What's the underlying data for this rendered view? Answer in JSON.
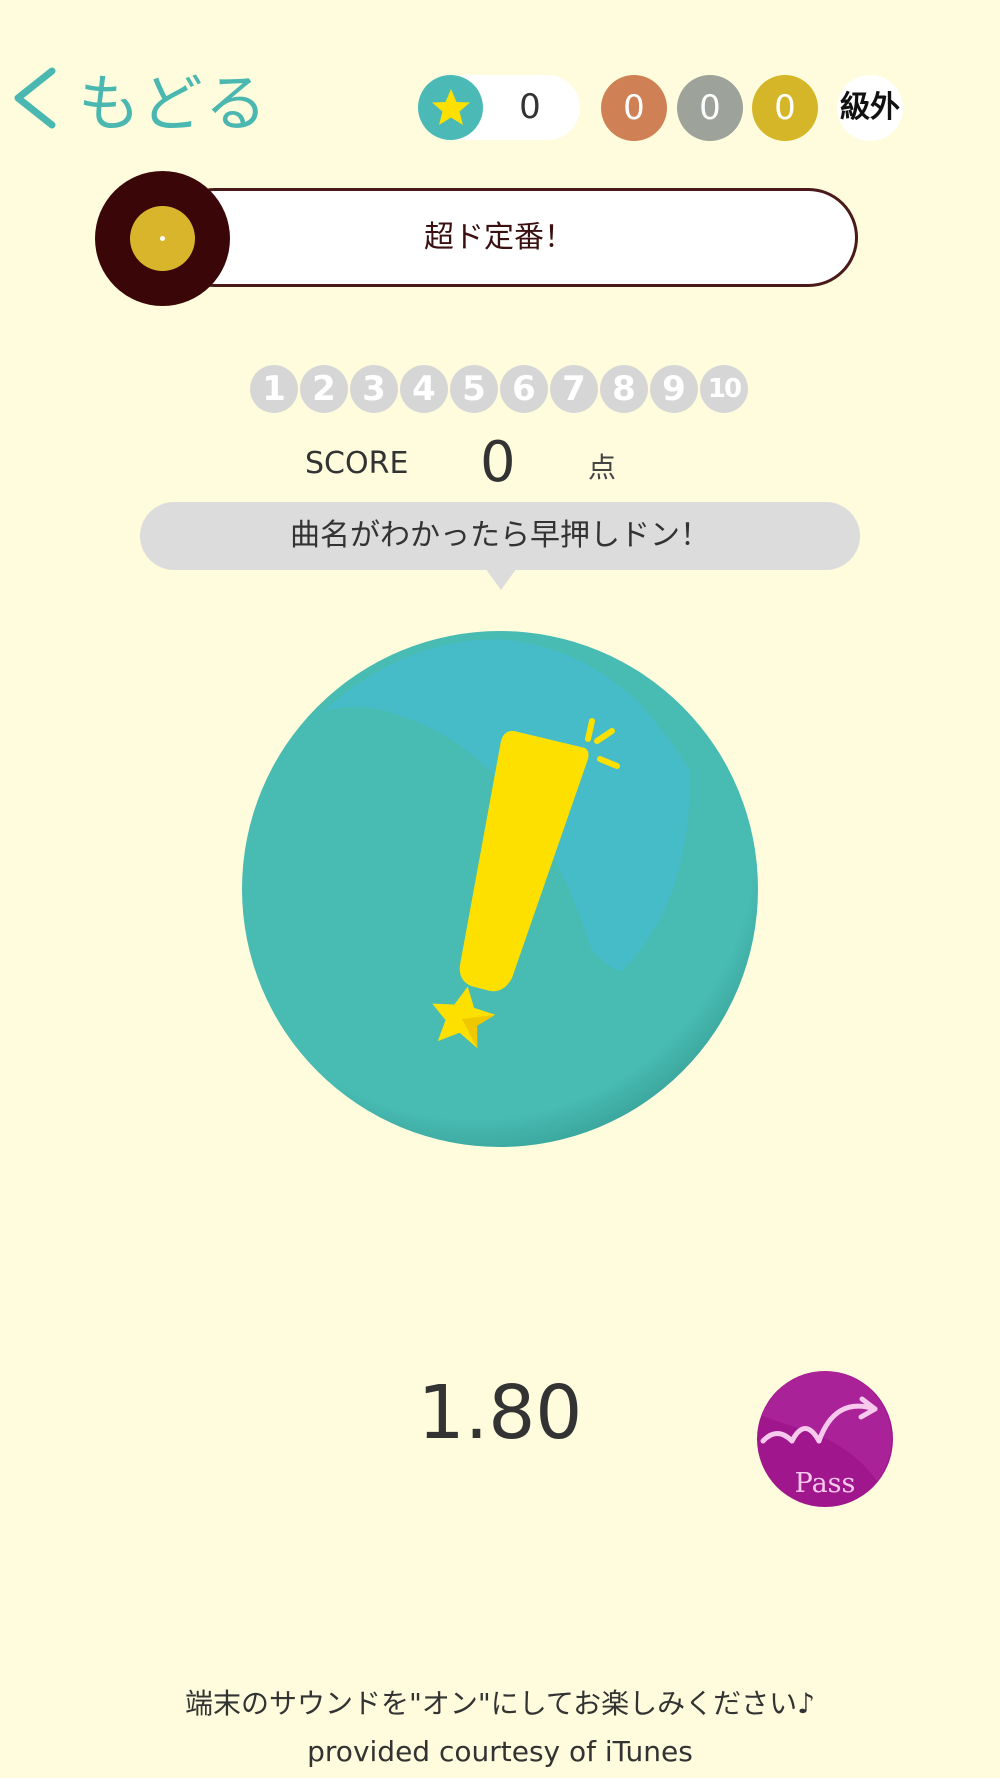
{
  "header": {
    "back_label": "もどる",
    "stars": "0",
    "medals": {
      "bronze": "0",
      "silver": "0",
      "gold": "0"
    },
    "rank": "級外"
  },
  "genre": {
    "title": "超ド定番！"
  },
  "progress": {
    "questions": [
      "1",
      "2",
      "3",
      "4",
      "5",
      "6",
      "7",
      "8",
      "9",
      "10"
    ]
  },
  "score": {
    "label": "SCORE",
    "value": "0",
    "unit": "点"
  },
  "prompt": {
    "text": "曲名がわかったら早押しドン！"
  },
  "timer": {
    "value": "1.80"
  },
  "pass": {
    "label": "Pass"
  },
  "footer": {
    "notice": "端末のサウンドを\"オン\"にしてお楽しみください♪",
    "credit": "provided courtesy of iTunes"
  },
  "colors": {
    "background": "#fefcdc",
    "teal": "#4ab8b0",
    "yellow": "#fde000",
    "bronze": "#cf8155",
    "silver": "#9da29b",
    "gold": "#d6b629",
    "record": "#3a0608",
    "pass": "#a0168d"
  },
  "icons": {
    "back": "chevron-left-icon",
    "star": "star-icon",
    "record": "vinyl-record-icon",
    "buzzer": "exclamation-icon",
    "pass": "pass-arrow-icon"
  }
}
